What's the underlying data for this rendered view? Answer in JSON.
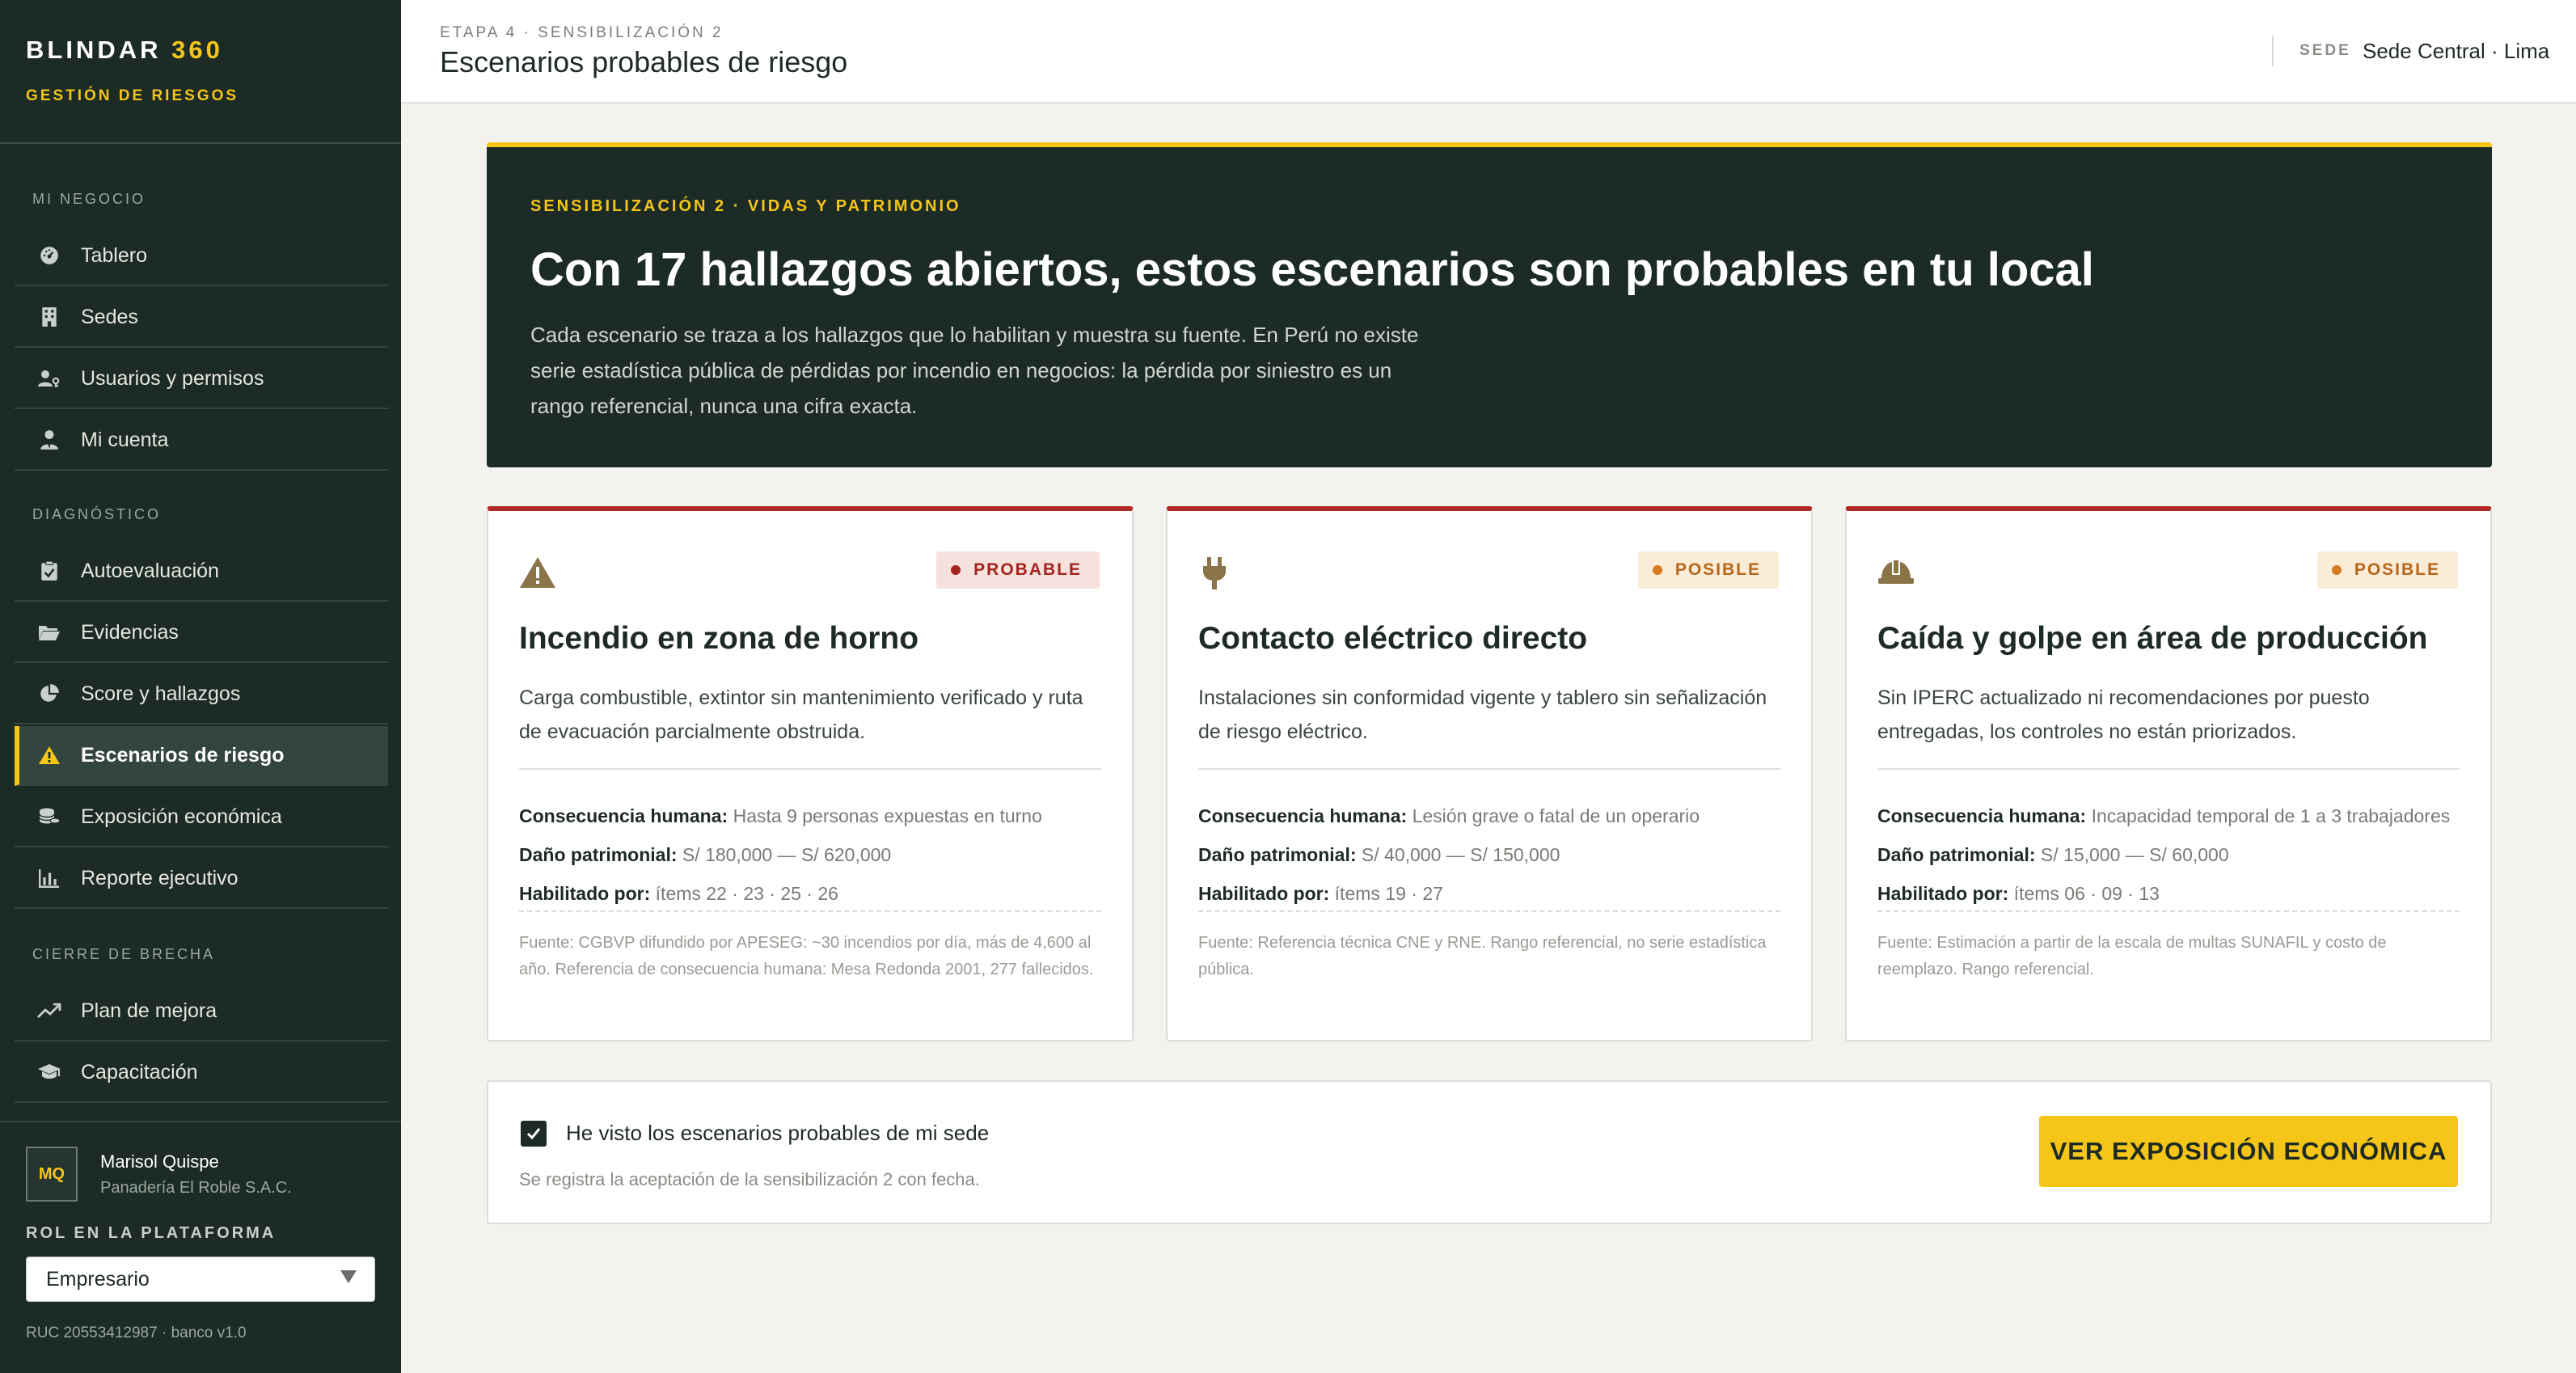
{
  "brand": {
    "name": "BLINDAR",
    "version": "360",
    "subtitle": "GESTIÓN DE RIESGOS"
  },
  "sidebar": {
    "sections": [
      {
        "title": "MI NEGOCIO",
        "items": [
          {
            "label": "Tablero",
            "icon": "dashboard-icon"
          },
          {
            "label": "Sedes",
            "icon": "building-icon"
          },
          {
            "label": "Usuarios y permisos",
            "icon": "users-key-icon"
          },
          {
            "label": "Mi cuenta",
            "icon": "user-tie-icon"
          }
        ]
      },
      {
        "title": "DIAGNÓSTICO",
        "items": [
          {
            "label": "Autoevaluación",
            "icon": "clipboard-check-icon"
          },
          {
            "label": "Evidencias",
            "icon": "folder-open-icon"
          },
          {
            "label": "Score y hallazgos",
            "icon": "pie-chart-icon"
          },
          {
            "label": "Escenarios de riesgo",
            "icon": "warning-icon",
            "active": true
          },
          {
            "label": "Exposición económica",
            "icon": "coins-icon"
          },
          {
            "label": "Reporte ejecutivo",
            "icon": "bar-chart-icon"
          }
        ]
      },
      {
        "title": "CIERRE DE BRECHA",
        "items": [
          {
            "label": "Plan de mejora",
            "icon": "trend-up-icon"
          },
          {
            "label": "Capacitación",
            "icon": "graduation-cap-icon"
          }
        ]
      }
    ]
  },
  "user": {
    "initials": "MQ",
    "name": "Marisol Quispe",
    "company": "Panadería El Roble S.A.C."
  },
  "role": {
    "label": "ROL EN LA PLATAFORMA",
    "selected": "Empresario"
  },
  "footer": {
    "ruc": "RUC 20553412987 · banco v1.0"
  },
  "header": {
    "breadcrumb": "ETAPA 4 · SENSIBILIZACIÓN 2",
    "title": "Escenarios probables de riesgo",
    "sede_label": "SEDE",
    "sede_value": "Sede Central · Lima"
  },
  "hero": {
    "kicker": "SENSIBILIZACIÓN 2 · VIDAS Y PATRIMONIO",
    "title": "Con 17 hallazgos abiertos, estos escenarios son probables en tu local",
    "description": "Cada escenario se traza a los hallazgos que lo habilitan y muestra su fuente. En Perú no existe serie estadística pública de pérdidas por incendio en negocios: la pérdida por siniestro es un rango referencial, nunca una cifra exacta."
  },
  "scenarios": [
    {
      "icon": "warning-icon",
      "badge": "PROBABLE",
      "title": "Incendio en zona de horno",
      "description": "Carga combustible, extintor sin mantenimiento verificado y ruta de evacuación parcialmente obstruida.",
      "human_label": "Consecuencia humana:",
      "human_value": "Hasta 9 personas expuestas en turno",
      "damage_label": "Daño patrimonial:",
      "damage_value": "S/ 180,000 — S/ 620,000",
      "enabled_label": "Habilitado por:",
      "enabled_value": "ítems 22 · 23 · 25 · 26",
      "source": "Fuente: CGBVP difundido por APESEG: ~30 incendios por día, más de 4,600 al año. Referencia de consecuencia humana: Mesa Redonda 2001, 277 fallecidos."
    },
    {
      "icon": "plug-icon",
      "badge": "POSIBLE",
      "title": "Contacto eléctrico directo",
      "description": "Instalaciones sin conformidad vigente y tablero sin señalización de riesgo eléctrico.",
      "human_label": "Consecuencia humana:",
      "human_value": "Lesión grave o fatal de un operario",
      "damage_label": "Daño patrimonial:",
      "damage_value": "S/ 40,000 — S/ 150,000",
      "enabled_label": "Habilitado por:",
      "enabled_value": "ítems 19 · 27",
      "source": "Fuente: Referencia técnica CNE y RNE. Rango referencial, no serie estadística pública."
    },
    {
      "icon": "hard-hat-icon",
      "badge": "POSIBLE",
      "title": "Caída y golpe en área de producción",
      "description": "Sin IPERC actualizado ni recomendaciones por puesto entregadas, los controles no están priorizados.",
      "human_label": "Consecuencia humana:",
      "human_value": "Incapacidad temporal de 1 a 3 trabajadores",
      "damage_label": "Daño patrimonial:",
      "damage_value": "S/ 15,000 — S/ 60,000",
      "enabled_label": "Habilitado por:",
      "enabled_value": "ítems 06 · 09 · 13",
      "source": "Fuente: Estimación a partir de la escala de multas SUNAFIL y costo de reemplazo. Rango referencial."
    }
  ],
  "confirm": {
    "checked": true,
    "label": "He visto los escenarios probables de mi sede",
    "hint": "Se registra la aceptación de la sensibilización 2 con fecha.",
    "cta": "VER EXPOSICIÓN ECONÓMICA"
  },
  "colors": {
    "sidebar_bg": "#1c2b25",
    "accent": "#f5c518",
    "probable": "#a3231f",
    "posible": "#d67a1f",
    "card_top": "#b02a25",
    "icon_brown": "#8a7448"
  }
}
